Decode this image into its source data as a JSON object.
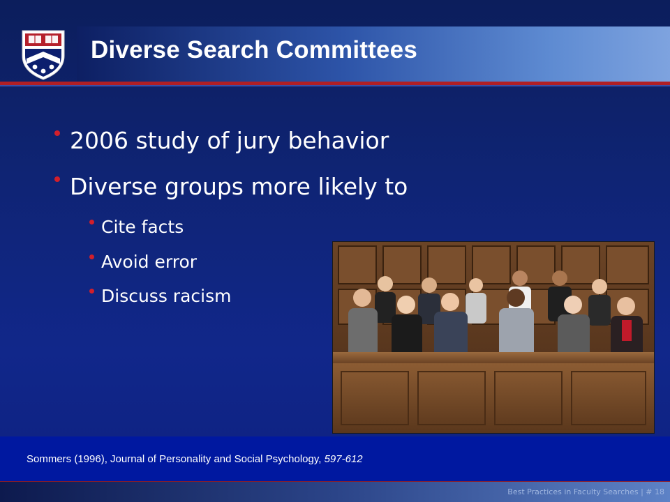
{
  "slide": {
    "title": "Diverse Search Committees",
    "bullets": [
      "2006 study of jury behavior",
      "Diverse groups more likely to"
    ],
    "sub_bullets": [
      "Cite facts",
      "Avoid error",
      "Discuss racism"
    ],
    "citation": {
      "prefix": "Sommers (1996), Journal of Personality and Social Psychology, ",
      "pages": "597-612"
    },
    "footer": "Best Practices in Faculty Searches | # 18"
  },
  "colors": {
    "background": "#11278a",
    "title_bar_start": "#0d1f63",
    "title_bar_end": "#7ea3df",
    "accent_red": "#b01f25",
    "bullet_dot": "#d21f2b",
    "citation_band": "#0018a0"
  },
  "icons": {
    "logo": "university-shield-logo",
    "photo": "jury-box-photo"
  }
}
